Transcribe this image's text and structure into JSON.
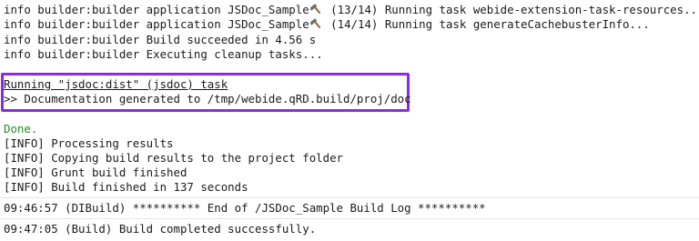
{
  "console": {
    "build_lines": [
      {
        "prefix": "info builder:builder application JSDoc_Sample",
        "suffix": "(13/14) Running task webide-extension-task-resources..."
      },
      {
        "prefix": "info builder:builder application JSDoc_Sample",
        "suffix": "(14/14) Running task generateCachebusterInfo..."
      },
      {
        "text": "info builder:builder Build succeeded in 4.56 s"
      },
      {
        "text": "info builder:builder Executing cleanup tasks..."
      }
    ],
    "jsdoc_task": "Running \"jsdoc:dist\" (jsdoc) task",
    "jsdoc_output": ">> Documentation generated to /tmp/webide.qRD.build/proj/doc",
    "done": "Done.",
    "info_lines": [
      "[INFO] Processing results",
      "[INFO] Copying build results to the project folder",
      "[INFO] Grunt build finished",
      "[INFO] Build finished in 137 seconds"
    ],
    "log_end": "09:46:57 (DIBuild) ********** End of /JSDoc_Sample Build Log **********",
    "log_complete": "09:47:05 (Build) Build completed successfully."
  },
  "icons": {
    "hammer": "hammer-icon"
  },
  "colors": {
    "highlight": "#8a2be2",
    "done_text": "#2a8a2a"
  }
}
